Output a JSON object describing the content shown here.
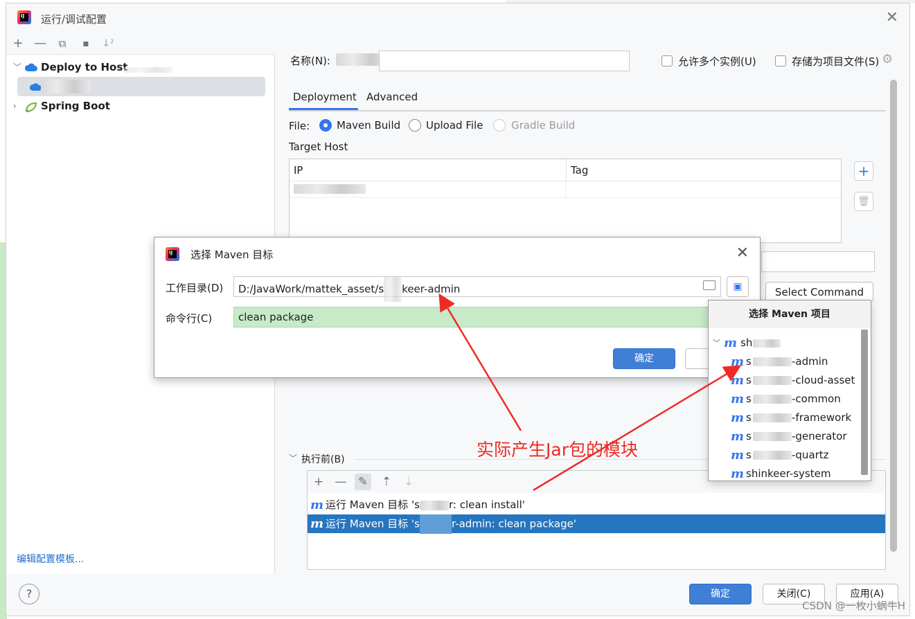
{
  "window": {
    "title": "运行/调试配置",
    "close": "✕"
  },
  "toolbar": {
    "add": "+",
    "remove": "—",
    "copy": "⧉",
    "folder": "▪",
    "sort": "↓²"
  },
  "tree": {
    "deploy_to_host": "Deploy to Host",
    "spring_boot": "Spring Boot"
  },
  "edit_templates": "编辑配置模板...",
  "name_label": "名称(N):",
  "allow_multiple": "允许多个实例(U)",
  "store_as_project_file": "存储为项目文件(S)",
  "tabs": [
    "Deployment",
    "Advanced"
  ],
  "file_label": "File:",
  "file_options": [
    {
      "label": "Maven Build",
      "state": "selected"
    },
    {
      "label": "Upload File",
      "state": "normal"
    },
    {
      "label": "Gradle Build",
      "state": "disabled"
    }
  ],
  "target_host_label": "Target Host",
  "host_table": {
    "headers": [
      "IP",
      "Tag"
    ]
  },
  "select_command": "Select Command",
  "before_launch": {
    "label": "执行前(B)",
    "rows": [
      "运行 Maven 目标 's",
      "运行 Maven 目标 's"
    ],
    "row_tails": [
      "r: clean install'",
      "r-admin: clean package'"
    ]
  },
  "footer": {
    "help": "?",
    "ok": "确定",
    "close": "关闭(C)",
    "apply": "应用(A)"
  },
  "goal_dialog": {
    "title": "选择 Maven 目标",
    "workdir_label": "工作目录(D)",
    "workdir_value": "D:/JavaWork/mattek_asset/s",
    "workdir_tail": "keer-admin",
    "cmdline_label": "命令行(C)",
    "cmdline_value": "clean package",
    "ok": "确定"
  },
  "project_popup": {
    "header": "选择 Maven 项目",
    "root": "sh",
    "modules": [
      "-admin",
      "-cloud-asset",
      "-common",
      "-framework",
      "-generator",
      "-quartz"
    ],
    "module_prefixes": [
      "s",
      "s",
      "s",
      "s",
      "s",
      "s"
    ],
    "last_module": "shinkeer-system"
  },
  "annotation": "实际产生Jar包的模块",
  "watermark": "CSDN @一枚小蜗牛H",
  "colors": {
    "accent": "#3574f0",
    "selection": "#2675bf",
    "annotation_red": "#ee2b24",
    "cmd_green": "#c7eac9"
  }
}
